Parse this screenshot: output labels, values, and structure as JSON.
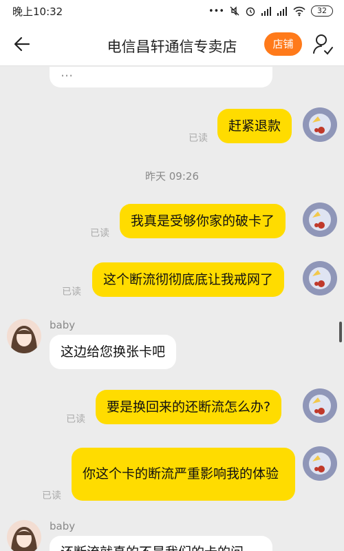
{
  "status_bar": {
    "time": "晚上10:32",
    "battery": "32",
    "icons": [
      "more-dots-icon",
      "mute-icon",
      "alarm-icon",
      "signal-icon",
      "hd-signal-icon",
      "wifi-icon",
      "battery-icon"
    ]
  },
  "header": {
    "title": "电信昌轩通信专卖店",
    "shop_button": "店铺",
    "colors": {
      "shop_button": "#ff7a1a"
    }
  },
  "chat": {
    "partial_top_text": "...",
    "read_label": "已读",
    "timestamp": "昨天  09:26",
    "sender_name": "baby",
    "messages": [
      {
        "from": "me",
        "text": "赶紧退款",
        "status": "已读"
      },
      {
        "from": "me",
        "text": "我真是受够你家的破卡了",
        "status": "已读"
      },
      {
        "from": "me",
        "text": "这个断流彻彻底底让我戒网了",
        "status": "已读"
      },
      {
        "from": "them",
        "sender": "baby",
        "text": "这边给您换张卡吧"
      },
      {
        "from": "me",
        "text": "要是换回来的还断流怎么办?",
        "status": "已读"
      },
      {
        "from": "me",
        "text": "你这个卡的断流严重影响我的体验",
        "status": "已读"
      },
      {
        "from": "them",
        "sender": "baby",
        "text": "还断流就真的不是我们的卡的问"
      }
    ],
    "colors": {
      "my_bubble": "#ffdc00",
      "their_bubble": "#ffffff",
      "background": "#ececec"
    }
  }
}
